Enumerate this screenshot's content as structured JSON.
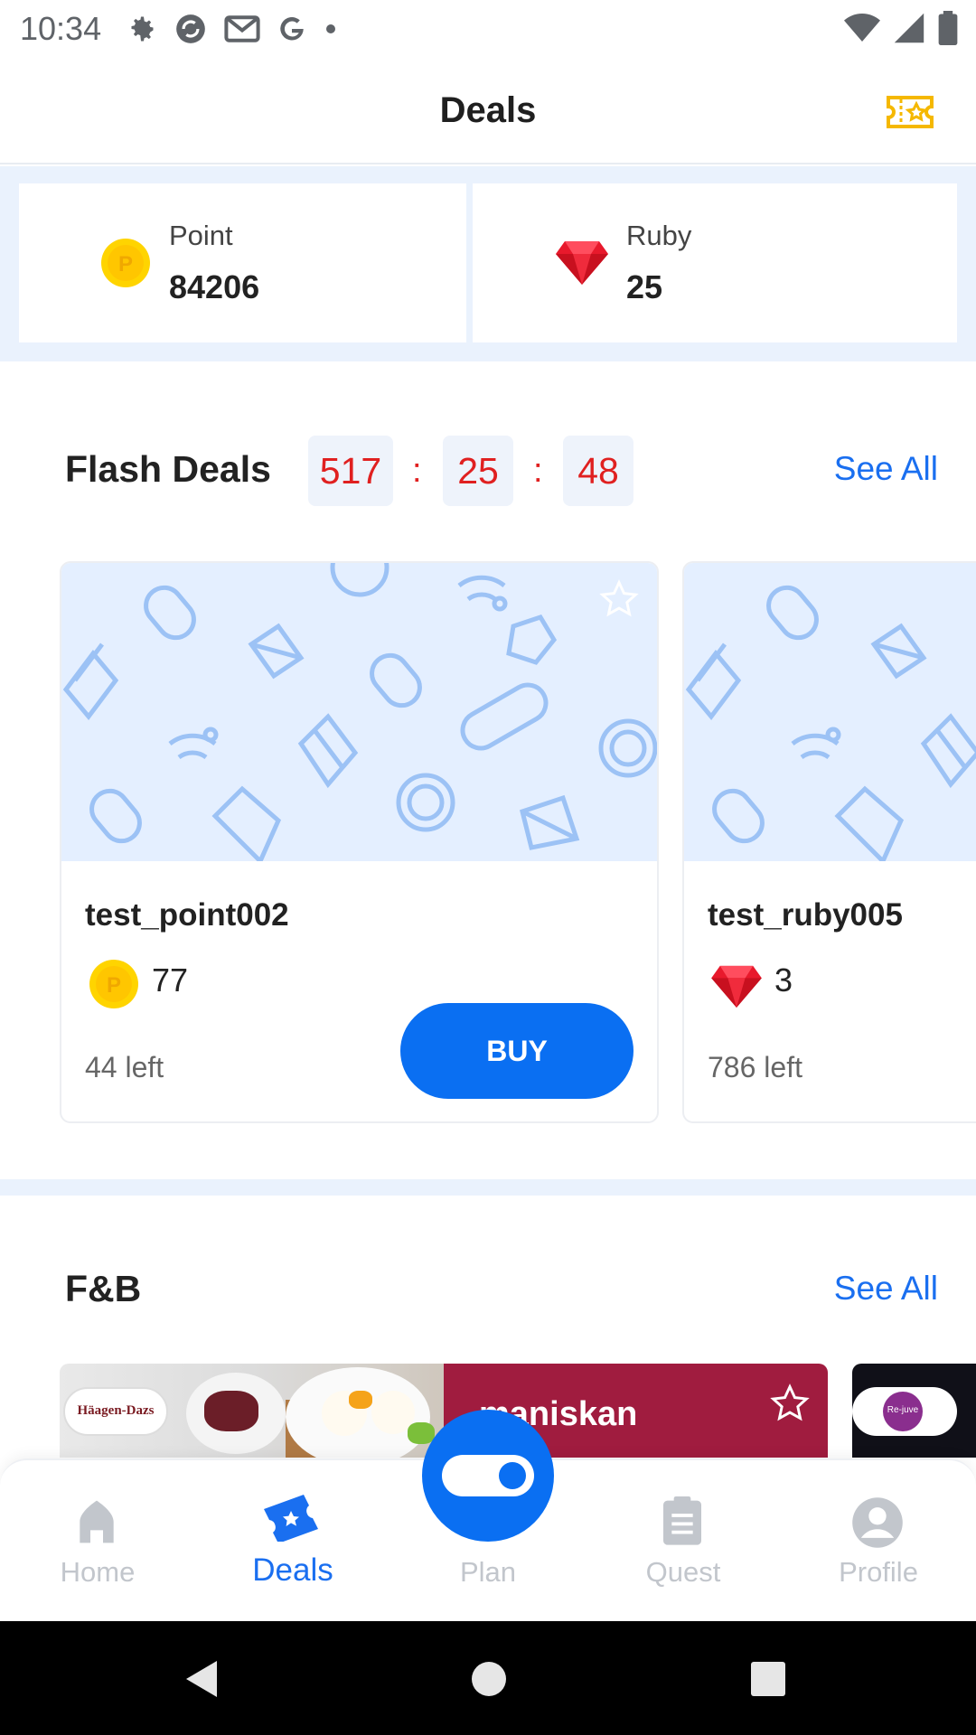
{
  "status_bar": {
    "time": "10:34"
  },
  "header": {
    "title": "Deals"
  },
  "balances": {
    "point": {
      "label": "Point",
      "value": "84206"
    },
    "ruby": {
      "label": "Ruby",
      "value": "25"
    }
  },
  "flash_deals": {
    "title": "Flash Deals",
    "see_all": "See All",
    "timer": {
      "hours": "517",
      "minutes": "25",
      "seconds": "48",
      "sep": ":"
    },
    "items": [
      {
        "name": "test_point002",
        "price": "77",
        "currency": "point",
        "left": "44  left",
        "buy": "BUY"
      },
      {
        "name": "test_ruby005",
        "price": "3",
        "currency": "ruby",
        "left": "786  left"
      }
    ]
  },
  "fnb": {
    "title": "F&B",
    "see_all": "See All",
    "banner_text": "maniskan",
    "brand": "Häagen-Dazs",
    "brand2": "Re-juve"
  },
  "bottom_nav": {
    "items": [
      {
        "label": "Home"
      },
      {
        "label": "Deals"
      },
      {
        "label": "Plan"
      },
      {
        "label": "Quest"
      },
      {
        "label": "Profile"
      }
    ]
  },
  "colors": {
    "accent": "#0a6ff2",
    "timer_red": "#e02020",
    "light_blue_bg": "#eaf2fd"
  }
}
